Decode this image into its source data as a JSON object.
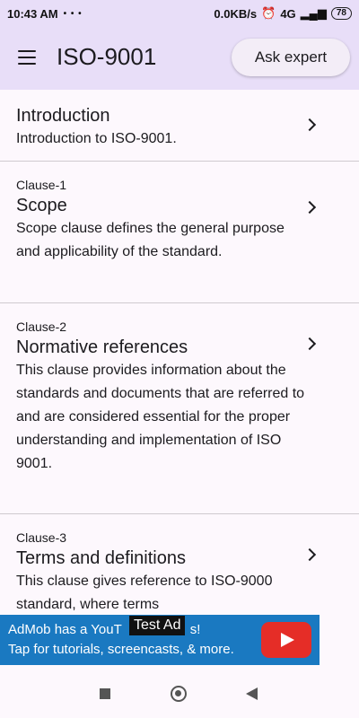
{
  "status": {
    "time": "10:43 AM",
    "dots": "• • •",
    "speed": "0.0KB/s",
    "network": "4G",
    "battery": "78"
  },
  "appbar": {
    "title": "ISO-9001",
    "ask_label": "Ask expert",
    "menu_icon": "hamburger-menu-icon"
  },
  "items": [
    {
      "clause": "",
      "title": "Introduction",
      "desc": "Introduction to ISO-9001."
    },
    {
      "clause": "Clause-1",
      "title": "Scope",
      "desc": "Scope clause defines the general purpose and applicability of the standard."
    },
    {
      "clause": "Clause-2",
      "title": "Normative references",
      "desc": "This clause provides information about the standards and documents that are referred to and are considered essential for the proper understanding and implementation of ISO 9001."
    },
    {
      "clause": "Clause-3",
      "title": "Terms and definitions",
      "desc": "This clause gives reference to ISO-9000 standard, where terms"
    }
  ],
  "ad": {
    "line1": "AdMob has a YouT",
    "line1_end": "s!",
    "line2": "Tap for tutorials, screencasts, & more.",
    "test_label": "Test Ad",
    "icon": "youtube-play-icon",
    "color": "#1a79c1"
  },
  "colors": {
    "appbar": "#e8def8",
    "background": "#fdf8fd",
    "divider": "#cfcacf"
  }
}
